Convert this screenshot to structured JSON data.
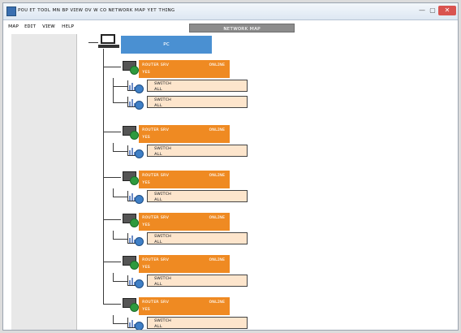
{
  "window": {
    "title": "ᴘᴏᴜ ᴇᴛ ᴛᴏᴏʟ ᴍɴ ʙᴘ ᴠɪᴇᴡ ᴏᴠ ᴡ ᴄᴏ ɴᴇᴛᴡᴏʀᴋ ᴍᴀᴘ ʏᴇᴛ ᴛʜɪɴɢ",
    "min_glyph": "—",
    "max_glyph": "▢",
    "close_glyph": "✕"
  },
  "menu": [
    "ᴍᴀᴘ",
    "ᴇᴅɪᴛ",
    "ᴠɪᴇᴡ",
    "ʜᴇʟᴘ"
  ],
  "header_banner": "ɴᴇᴛᴡᴏʀᴋ ᴍᴀᴘ",
  "tree": {
    "root_label": "ᴘᴄ",
    "nodes": [
      {
        "title": "ʀᴏᴜᴛᴇʀ ꜱʀᴠ",
        "right": "ᴏɴʟɪɴᴇ",
        "sub": "ʏᴇꜱ",
        "children": [
          {
            "title": "ꜱᴡɪᴛᴄʜ",
            "sub": "ᴀʟʟ"
          },
          {
            "title": "ꜱᴡɪᴛᴄʜ",
            "sub": "ᴀʟʟ"
          }
        ]
      },
      {
        "title": "ʀᴏᴜᴛᴇʀ ꜱʀᴠ",
        "right": "ᴏɴʟɪɴᴇ",
        "sub": "ʏᴇꜱ",
        "children": [
          {
            "title": "ꜱᴡɪᴛᴄʜ",
            "sub": "ᴀʟʟ"
          }
        ]
      },
      {
        "title": "ʀᴏᴜᴛᴇʀ ꜱʀᴠ",
        "right": "ᴏɴʟɪɴᴇ",
        "sub": "ʏᴇꜱ",
        "children": [
          {
            "title": "ꜱᴡɪᴛᴄʜ",
            "sub": "ᴀʟʟ"
          }
        ]
      },
      {
        "title": "ʀᴏᴜᴛᴇʀ ꜱʀᴠ",
        "right": "ᴏɴʟɪɴᴇ",
        "sub": "ʏᴇꜱ",
        "children": [
          {
            "title": "ꜱᴡɪᴛᴄʜ",
            "sub": "ᴀʟʟ"
          }
        ]
      },
      {
        "title": "ʀᴏᴜᴛᴇʀ ꜱʀᴠ",
        "right": "ᴏɴʟɪɴᴇ",
        "sub": "ʏᴇꜱ",
        "children": [
          {
            "title": "ꜱᴡɪᴛᴄʜ",
            "sub": "ᴀʟʟ"
          }
        ]
      },
      {
        "title": "ʀᴏᴜᴛᴇʀ ꜱʀᴠ",
        "right": "ᴏɴʟɪɴᴇ",
        "sub": "ʏᴇꜱ",
        "children": [
          {
            "title": "ꜱᴡɪᴛᴄʜ",
            "sub": "ᴀʟʟ"
          }
        ]
      }
    ]
  },
  "colors": {
    "root": "#4a90d2",
    "node": "#ef8a22",
    "child": "#fde5cc",
    "status_dot": "#2e9a3e",
    "globe": "#3f7fc6"
  },
  "icons": {
    "root": "computer-monitor-icon",
    "node": "network-device-icon",
    "child": "bar-chart-globe-icon"
  }
}
